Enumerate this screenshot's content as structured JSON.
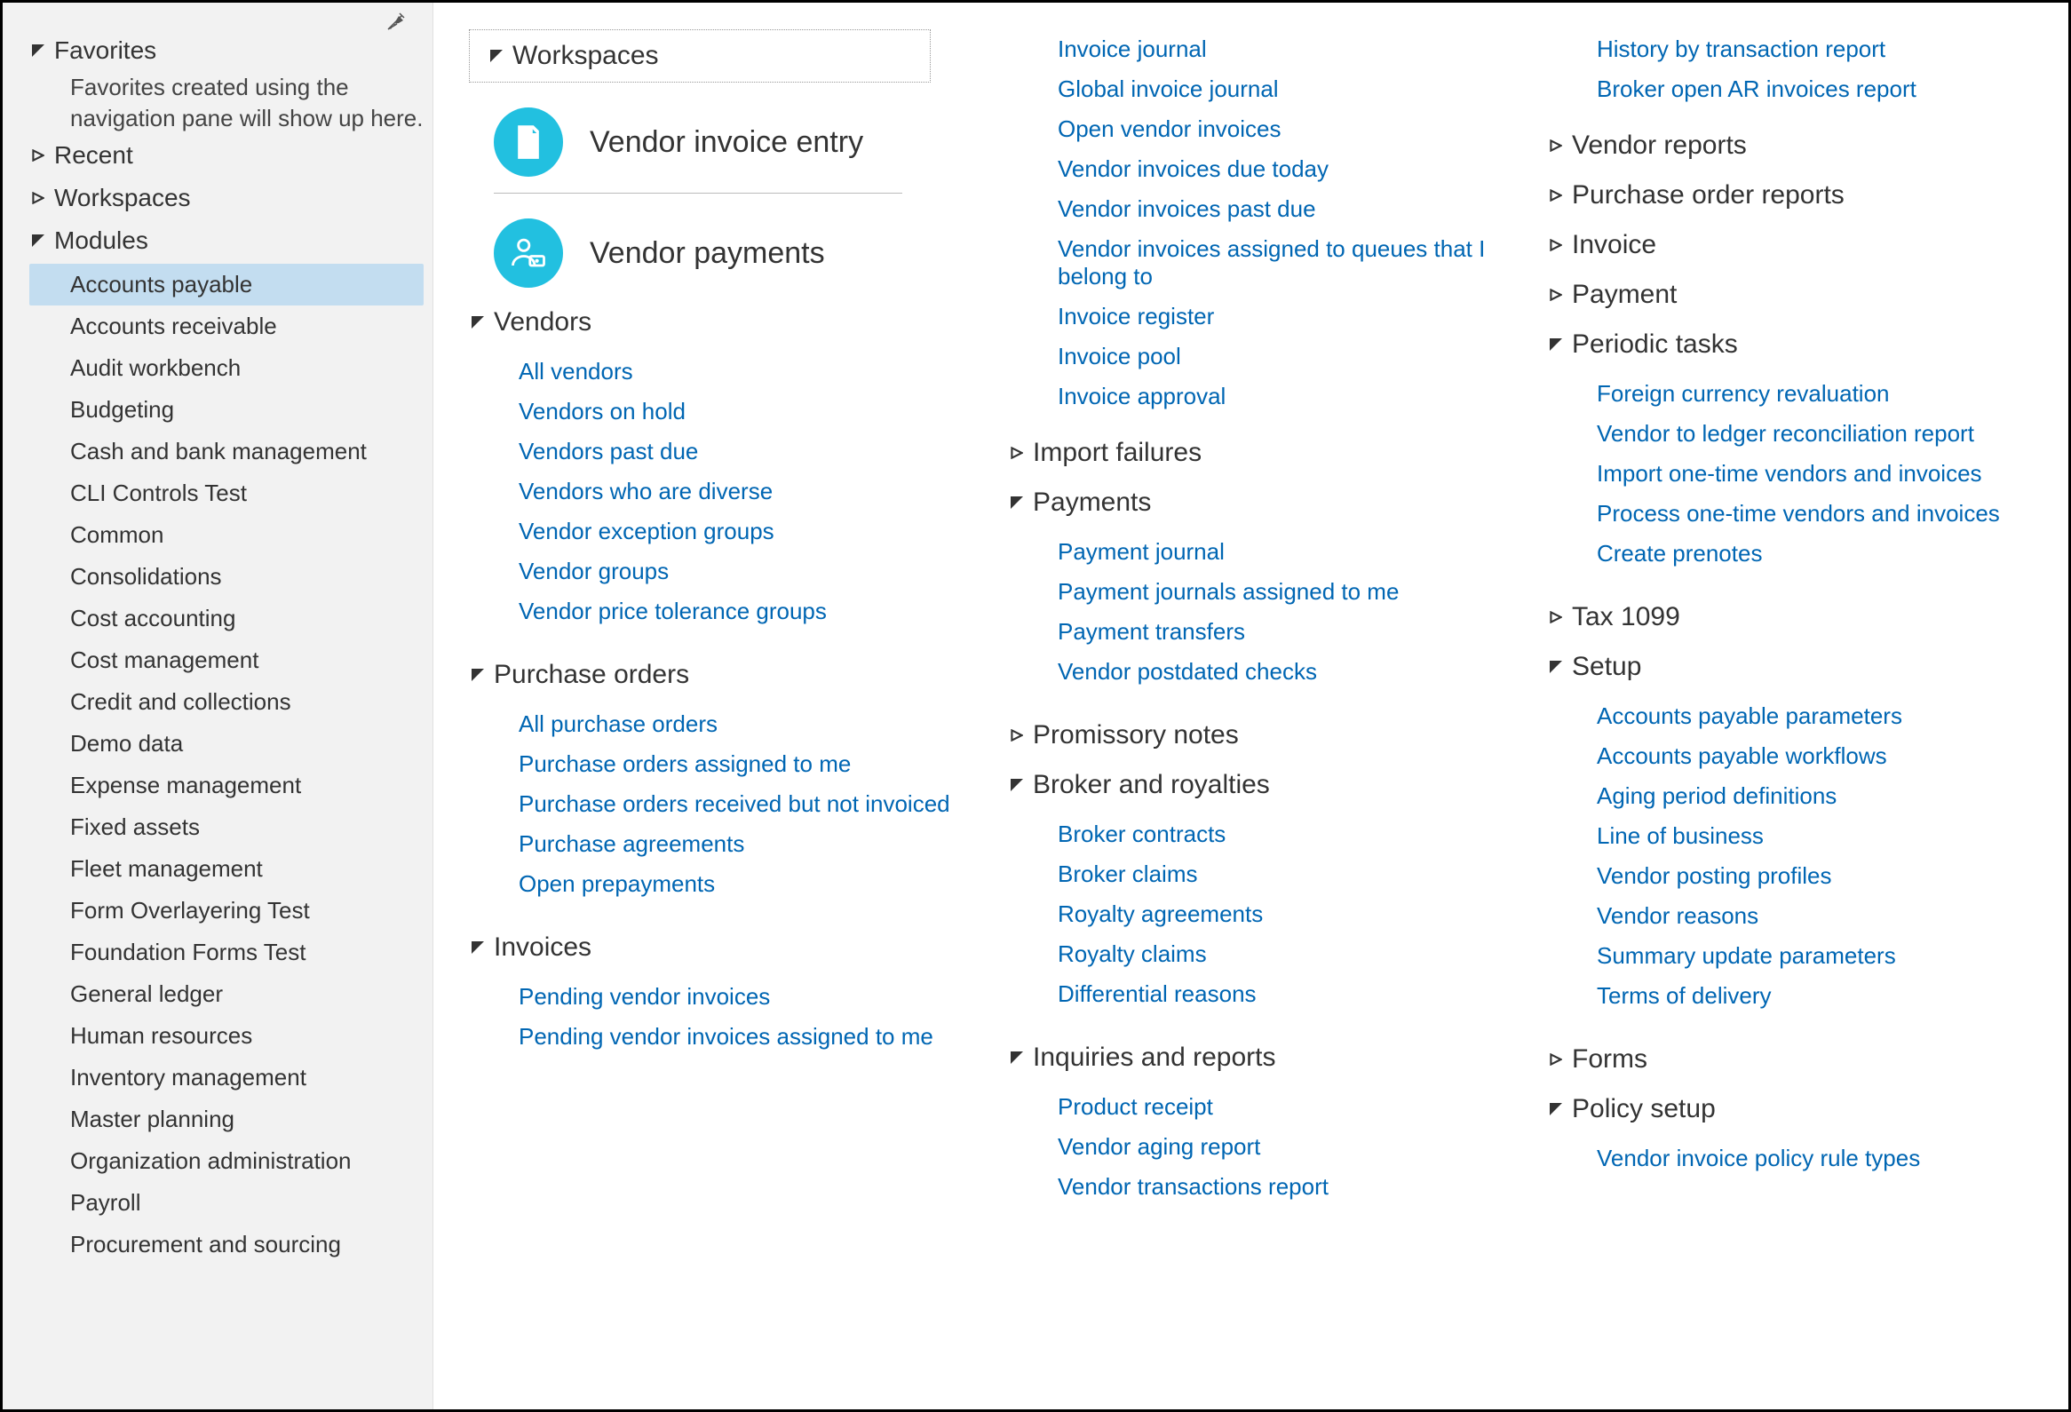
{
  "sidebar": {
    "favorites": {
      "label": "Favorites",
      "empty": "Favorites created using the navigation pane will show up here."
    },
    "recent": {
      "label": "Recent"
    },
    "workspaces": {
      "label": "Workspaces"
    },
    "modules": {
      "label": "Modules",
      "items": [
        "Accounts payable",
        "Accounts receivable",
        "Audit workbench",
        "Budgeting",
        "Cash and bank management",
        "CLI Controls Test",
        "Common",
        "Consolidations",
        "Cost accounting",
        "Cost management",
        "Credit and collections",
        "Demo data",
        "Expense management",
        "Fixed assets",
        "Fleet management",
        "Form Overlayering Test",
        "Foundation Forms Test",
        "General ledger",
        "Human resources",
        "Inventory management",
        "Master planning",
        "Organization administration",
        "Payroll",
        "Procurement and sourcing"
      ],
      "selected_index": 0
    }
  },
  "main": {
    "col1": {
      "workspaces_header": "Workspaces",
      "tiles": [
        {
          "label": "Vendor invoice entry",
          "icon": "document-invoice-icon"
        },
        {
          "label": "Vendor payments",
          "icon": "user-money-icon"
        }
      ],
      "groups": [
        {
          "title": "Vendors",
          "expanded": true,
          "links": [
            "All vendors",
            "Vendors on hold",
            "Vendors past due",
            "Vendors who are diverse",
            "Vendor exception groups",
            "Vendor groups",
            "Vendor price tolerance groups"
          ]
        },
        {
          "title": "Purchase orders",
          "expanded": true,
          "links": [
            "All purchase orders",
            "Purchase orders assigned to me",
            "Purchase orders received but not invoiced",
            "Purchase agreements",
            "Open prepayments"
          ]
        },
        {
          "title": "Invoices",
          "expanded": true,
          "links": [
            "Pending vendor invoices",
            "Pending vendor invoices assigned to me"
          ]
        }
      ]
    },
    "col2": {
      "top_links": [
        "Invoice journal",
        "Global invoice journal",
        "Open vendor invoices",
        "Vendor invoices due today",
        "Vendor invoices past due",
        "Vendor invoices assigned to queues that I belong to",
        "Invoice register",
        "Invoice pool",
        "Invoice approval"
      ],
      "groups": [
        {
          "title": "Import failures",
          "expanded": false,
          "links": []
        },
        {
          "title": "Payments",
          "expanded": true,
          "links": [
            "Payment journal",
            "Payment journals assigned to me",
            "Payment transfers",
            "Vendor postdated checks"
          ]
        },
        {
          "title": "Promissory notes",
          "expanded": false,
          "links": []
        },
        {
          "title": "Broker and royalties",
          "expanded": true,
          "links": [
            "Broker contracts",
            "Broker claims",
            "Royalty agreements",
            "Royalty claims",
            "Differential reasons"
          ]
        },
        {
          "title": "Inquiries and reports",
          "expanded": true,
          "links": [
            "Product receipt",
            "Vendor aging report",
            "Vendor transactions report"
          ]
        }
      ]
    },
    "col3": {
      "top_links": [
        "History by transaction report",
        "Broker open AR invoices report"
      ],
      "groups": [
        {
          "title": "Vendor reports",
          "expanded": false,
          "links": []
        },
        {
          "title": "Purchase order reports",
          "expanded": false,
          "links": []
        },
        {
          "title": "Invoice",
          "expanded": false,
          "links": []
        },
        {
          "title": "Payment",
          "expanded": false,
          "links": []
        },
        {
          "title": "Periodic tasks",
          "expanded": true,
          "links": [
            "Foreign currency revaluation",
            "Vendor to ledger reconciliation report",
            "Import one-time vendors and invoices",
            "Process one-time vendors and invoices",
            "Create prenotes"
          ]
        },
        {
          "title": "Tax 1099",
          "expanded": false,
          "links": []
        },
        {
          "title": "Setup",
          "expanded": true,
          "links": [
            "Accounts payable parameters",
            "Accounts payable workflows",
            "Aging period definitions",
            "Line of business",
            "Vendor posting profiles",
            "Vendor reasons",
            "Summary update parameters",
            "Terms of delivery"
          ]
        },
        {
          "title": "Forms",
          "expanded": false,
          "links": []
        },
        {
          "title": "Policy setup",
          "expanded": true,
          "links": [
            "Vendor invoice policy rule types"
          ]
        }
      ]
    }
  }
}
